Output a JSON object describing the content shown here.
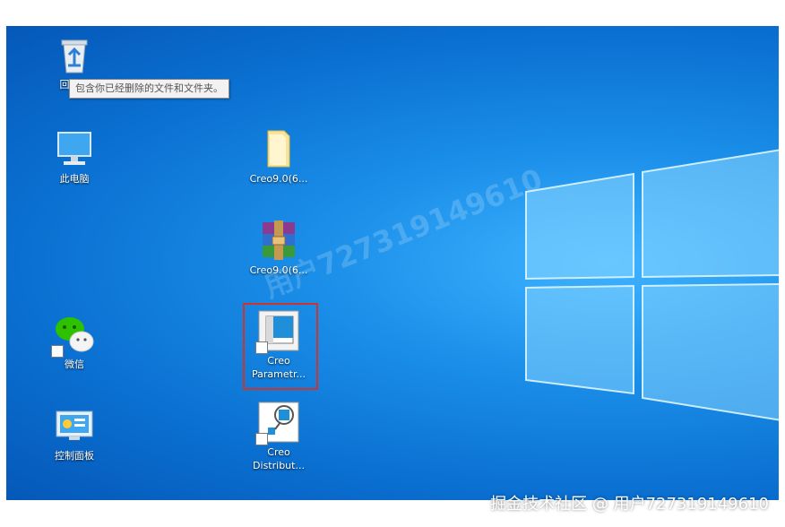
{
  "desktop": {
    "icons": {
      "recycle_bin": "回收站",
      "this_pc": "此电脑",
      "creo_folder": "Creo9.0(6...",
      "creo_archive": "Creo9.0(6...",
      "wechat": "微信",
      "creo_parametric": "Creo\nParametr...",
      "control_panel": "控制面板",
      "creo_distributed": "Creo\nDistribut..."
    },
    "tooltip": "包含你已经删除的文件和文件夹。",
    "watermark_diagonal": "用户727319149610",
    "watermark_bottom": "掘金技术社区 @ 用户727319149610"
  },
  "colors": {
    "desktop_blue": "#0a6fd0",
    "selection_red": "#d0332a"
  }
}
